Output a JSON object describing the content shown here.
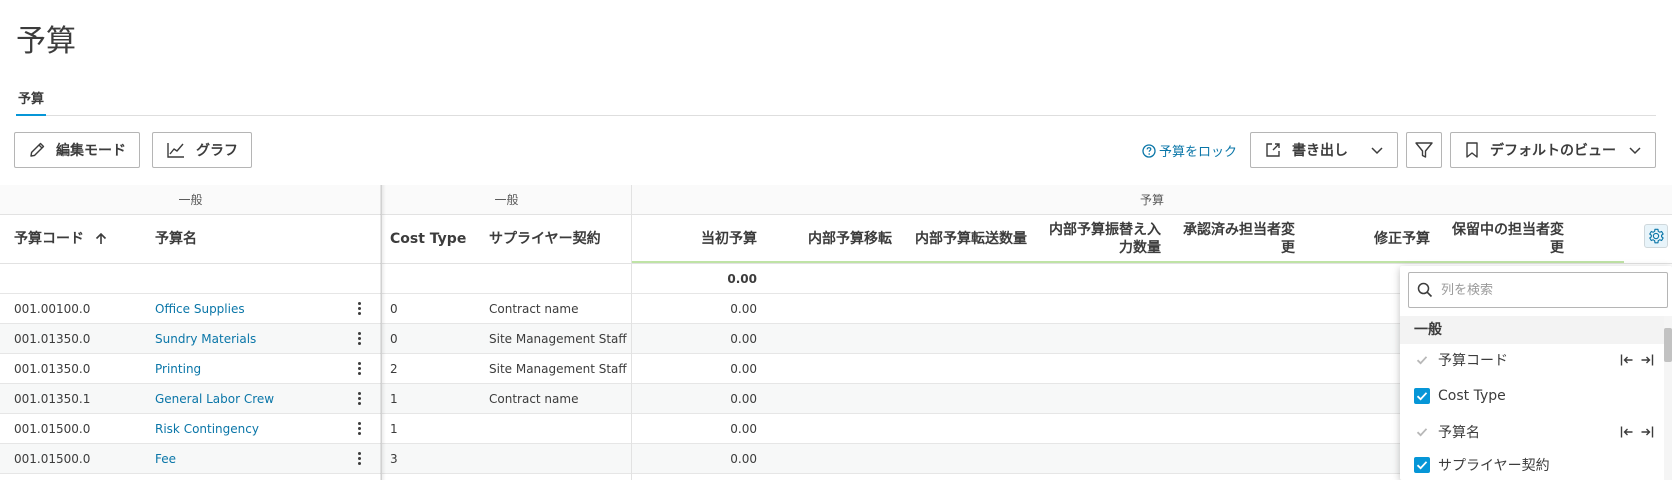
{
  "page": {
    "title": "予算"
  },
  "tabs": [
    {
      "label": "予算",
      "active": true
    }
  ],
  "toolbar": {
    "edit_mode": "編集モード",
    "graph": "グラフ",
    "lock_budget": "予算をロック",
    "export": "書き出し",
    "default_view": "デフォルトのビュー"
  },
  "grid": {
    "group_headers": {
      "pinned": "一般",
      "general": "一般",
      "budget": "予算"
    },
    "columns": {
      "budget_code": "予算コード",
      "budget_name": "予算名",
      "cost_type": "Cost Type",
      "supplier_contract": "サプライヤー契約",
      "original_budget": "当初予算",
      "internal_transfer": "内部予算移転",
      "internal_transfer_qty": "内部予算転送数量",
      "internal_adjust_input_qty_1": "内部予算振替え入",
      "internal_adjust_input_qty_2": "力数量",
      "approved_owner_change_1": "承認済み担当者変",
      "approved_owner_change_2": "更",
      "revised_budget": "修正予算",
      "pending_owner_change_1": "保留中の担当者変",
      "pending_owner_change_2": "更"
    },
    "totals": {
      "original_budget": "0.00"
    },
    "rows": [
      {
        "code": "001.00100.0",
        "name": "Office Supplies",
        "cost_type": "0",
        "contract": "Contract name",
        "original": "0.00"
      },
      {
        "code": "001.01350.0",
        "name": "Sundry Materials",
        "cost_type": "0",
        "contract": "Site Management Staff",
        "original": "0.00"
      },
      {
        "code": "001.01350.0",
        "name": "Printing",
        "cost_type": "2",
        "contract": "Site Management Staff",
        "original": "0.00"
      },
      {
        "code": "001.01350.1",
        "name": "General Labor Crew",
        "cost_type": "1",
        "contract": "Contract name",
        "original": "0.00"
      },
      {
        "code": "001.01500.0",
        "name": "Risk Contingency",
        "cost_type": "1",
        "contract": "",
        "original": "0.00"
      },
      {
        "code": "001.01500.0",
        "name": "Fee",
        "cost_type": "3",
        "contract": "",
        "original": "0.00"
      }
    ]
  },
  "column_panel": {
    "search_placeholder": "列を検索",
    "group_label": "一般",
    "items": [
      {
        "label": "予算コード",
        "state": "disabled"
      },
      {
        "label": "Cost Type",
        "state": "checked"
      },
      {
        "label": "予算名",
        "state": "disabled"
      },
      {
        "label": "サプライヤー契約",
        "state": "checked"
      }
    ]
  },
  "colors": {
    "accent": "#0696d7",
    "link": "#0a76a8"
  }
}
